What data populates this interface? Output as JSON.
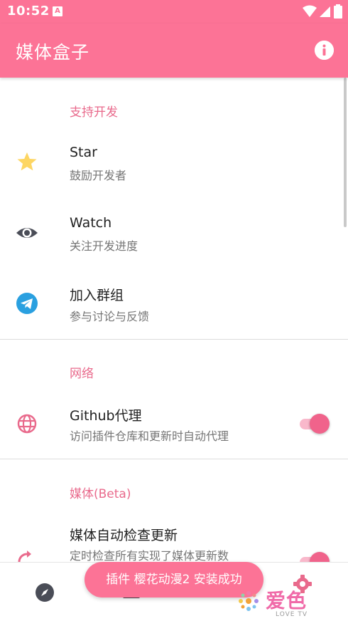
{
  "status_bar": {
    "time": "10:52",
    "notification_letter": "A"
  },
  "app_bar": {
    "title": "媒体盒子",
    "info_icon": "info-icon"
  },
  "sections": {
    "support": {
      "header": "支持开发",
      "items": [
        {
          "title": "Star",
          "subtitle": "鼓励开发者",
          "icon": "star-icon"
        },
        {
          "title": "Watch",
          "subtitle": "关注开发进度",
          "icon": "eye-icon"
        },
        {
          "title": "加入群组",
          "subtitle": "参与讨论与反馈",
          "icon": "telegram-icon"
        }
      ]
    },
    "network": {
      "header": "网络",
      "items": [
        {
          "title": "Github代理",
          "subtitle": "访问插件仓库和更新时自动代理",
          "icon": "globe-icon",
          "toggle_on": true
        }
      ]
    },
    "media": {
      "header": "媒体(Beta)",
      "items": [
        {
          "title": "媒体自动检查更新",
          "subtitle": "定时检查所有实现了媒体更新数",
          "icon": "refresh-icon",
          "toggle_on": true
        }
      ]
    }
  },
  "toast": {
    "message": "插件 樱花动漫2 安装成功"
  },
  "bottom_nav": {
    "items": [
      "compass-icon",
      "media-icon",
      "settings-icon"
    ]
  },
  "watermark": {
    "text": "爱色",
    "subtext": "LOVE TV"
  },
  "colors": {
    "primary": "#fc7396",
    "accent": "#e96a8c",
    "star": "#fdd663",
    "telegram": "#2aa0e0"
  }
}
